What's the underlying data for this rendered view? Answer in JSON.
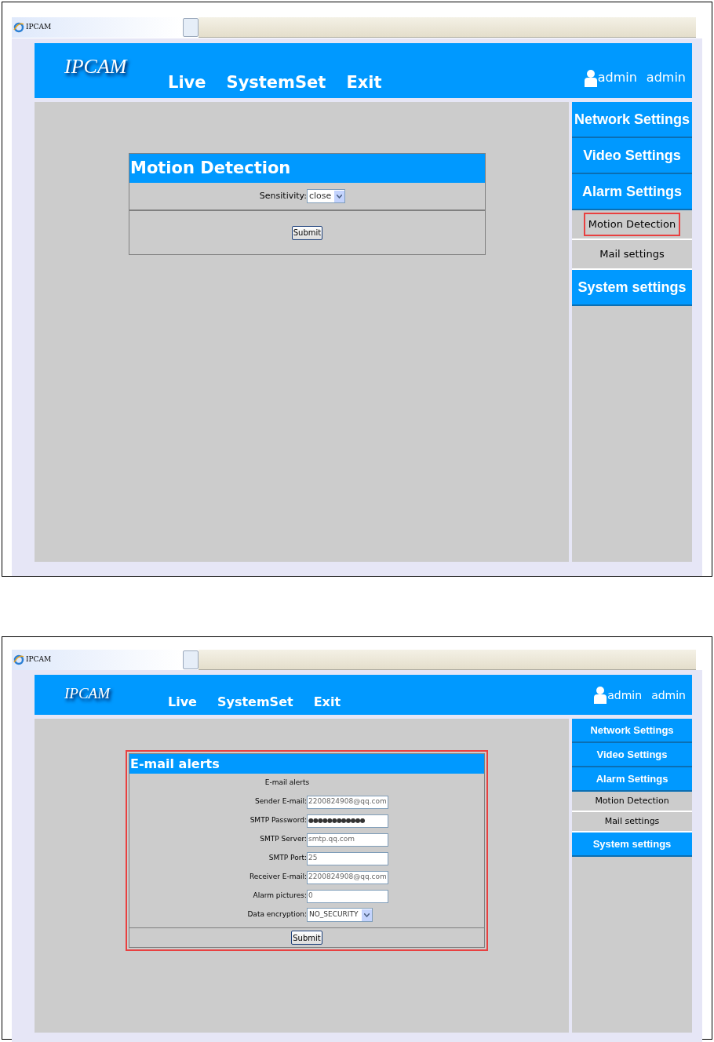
{
  "screens": [
    {
      "tab_title": "IPCAM",
      "logo": "IPCAM",
      "nav": [
        "Live",
        "SystemSet",
        "Exit"
      ],
      "user_label": "admin",
      "user_name": "admin",
      "sidebar": [
        {
          "label": "Network Settings",
          "kind": "section",
          "highlighted": false
        },
        {
          "label": "Video Settings",
          "kind": "section",
          "highlighted": false
        },
        {
          "label": "Alarm Settings",
          "kind": "section",
          "highlighted": false
        },
        {
          "label": "Motion Detection",
          "kind": "sub",
          "highlighted": true
        },
        {
          "label": "Mail settings",
          "kind": "sub",
          "highlighted": false
        },
        {
          "label": "System settings",
          "kind": "section",
          "highlighted": false
        }
      ],
      "form": {
        "title": "Motion Detection",
        "highlighted": false,
        "fields": [
          {
            "label": "Sensitivity:",
            "value": "close",
            "kind": "select"
          }
        ],
        "submit": "Submit"
      }
    },
    {
      "tab_title": "IPCAM",
      "logo": "IPCAM",
      "nav": [
        "Live",
        "SystemSet",
        "Exit"
      ],
      "user_label": "admin",
      "user_name": "admin",
      "sidebar": [
        {
          "label": "Network Settings",
          "kind": "section",
          "highlighted": false
        },
        {
          "label": "Video Settings",
          "kind": "section",
          "highlighted": false
        },
        {
          "label": "Alarm Settings",
          "kind": "section",
          "highlighted": false
        },
        {
          "label": "Motion Detection",
          "kind": "sub",
          "highlighted": false
        },
        {
          "label": "Mail settings",
          "kind": "sub",
          "highlighted": false
        },
        {
          "label": "System settings",
          "kind": "section",
          "highlighted": false
        }
      ],
      "form": {
        "title": "E-mail alerts",
        "highlighted": true,
        "subtitle": "E-mail alerts",
        "fields": [
          {
            "label": "Sender E-mail:",
            "value": "2200824908@qq.com",
            "kind": "text"
          },
          {
            "label": "SMTP Password:",
            "value": "●●●●●●●●●●●●",
            "kind": "password"
          },
          {
            "label": "SMTP Server:",
            "value": "smtp.qq.com",
            "kind": "text"
          },
          {
            "label": "SMTP Port:",
            "value": "25",
            "kind": "text"
          },
          {
            "label": "Receiver E-mail:",
            "value": "2200824908@qq.com",
            "kind": "text"
          },
          {
            "label": "Alarm pictures:",
            "value": "0",
            "kind": "text"
          },
          {
            "label": "Data encryption:",
            "value": "NO_SECURITY",
            "kind": "select"
          }
        ],
        "submit": "Submit"
      }
    }
  ]
}
